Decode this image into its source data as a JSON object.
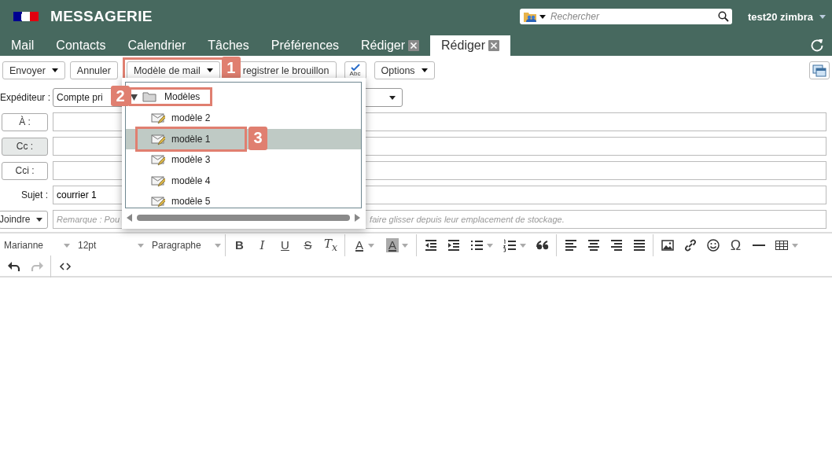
{
  "header": {
    "title": "MESSAGERIE",
    "search": {
      "placeholder": "Rechercher"
    },
    "user": "test20 zimbra"
  },
  "tabs": [
    {
      "label": "Mail",
      "selected": false,
      "closable": false
    },
    {
      "label": "Contacts",
      "selected": false,
      "closable": false
    },
    {
      "label": "Calendrier",
      "selected": false,
      "closable": false
    },
    {
      "label": "Tâches",
      "selected": false,
      "closable": false
    },
    {
      "label": "Préférences",
      "selected": false,
      "closable": false
    },
    {
      "label": "Rédiger",
      "selected": false,
      "closable": true
    },
    {
      "label": "Rédiger",
      "selected": true,
      "closable": true
    }
  ],
  "toolbar": {
    "buttons": [
      {
        "kind": "menu",
        "label": "Envoyer"
      },
      {
        "kind": "plain",
        "label": "Annuler"
      },
      {
        "kind": "menu",
        "label": "Modèle de mail",
        "annotation": "1"
      },
      {
        "kind": "plain",
        "label": "registrer le brouillon"
      },
      {
        "kind": "spell",
        "label": "Abc"
      },
      {
        "kind": "menu",
        "label": "Options"
      }
    ]
  },
  "form": {
    "sender": {
      "label": "Expéditeur :",
      "value": "Compte pri"
    },
    "recipients": [
      {
        "label": "À :",
        "hovered": false
      },
      {
        "label": "Cc :",
        "hovered": true
      },
      {
        "label": "Cci :",
        "hovered": false
      }
    ],
    "subject": {
      "label": "Sujet :",
      "value": "courrier 1"
    },
    "attach": {
      "label": "Joindre",
      "placeholder_start": "Remarque : Pou",
      "placeholder_end": "faire glisser depuis leur emplacement de stockage."
    }
  },
  "editor_toolbar": {
    "selects": [
      {
        "value": "Marianne"
      },
      {
        "value": "12pt"
      },
      {
        "value": "Paragraphe"
      }
    ],
    "groups": [
      [
        {
          "kind": "bold",
          "label": "B"
        },
        {
          "kind": "italic",
          "label": "I"
        },
        {
          "kind": "underline",
          "label": "U"
        },
        {
          "kind": "strike",
          "label": "S"
        },
        {
          "kind": "clear",
          "label": "T$_{x}$"
        }
      ],
      [
        {
          "kind": "color",
          "label": "A",
          "dropdown": true
        },
        {
          "kind": "highlight",
          "label": "A",
          "dropdown": true
        }
      ],
      [
        {
          "kind": "outdent"
        },
        {
          "kind": "indent"
        },
        {
          "kind": "bullets",
          "dropdown": true
        },
        {
          "kind": "numbers",
          "dropdown": true
        },
        {
          "kind": "quote"
        }
      ],
      [
        {
          "kind": "align-left"
        },
        {
          "kind": "align-center"
        },
        {
          "kind": "align-right"
        },
        {
          "kind": "justify"
        }
      ],
      [
        {
          "kind": "image"
        },
        {
          "kind": "link"
        },
        {
          "kind": "emoji"
        },
        {
          "kind": "char",
          "label": "Ω"
        },
        {
          "kind": "hr"
        },
        {
          "kind": "table",
          "dropdown": true
        }
      ]
    ],
    "row2": [
      [
        {
          "kind": "undo",
          "disabled": false
        },
        {
          "kind": "redo",
          "disabled": true
        }
      ],
      [
        {
          "kind": "code"
        }
      ]
    ]
  },
  "template_menu": {
    "folder": {
      "label": "Modèles",
      "expanded": true,
      "annotation": "2",
      "children": [
        {
          "label": "modèle 2",
          "selected": false
        },
        {
          "label": "modèle 1",
          "selected": true,
          "annotation": "3"
        },
        {
          "label": "modèle 3",
          "selected": false
        },
        {
          "label": "modèle 4",
          "selected": false
        },
        {
          "label": "modèle 5",
          "selected": false
        }
      ]
    }
  }
}
